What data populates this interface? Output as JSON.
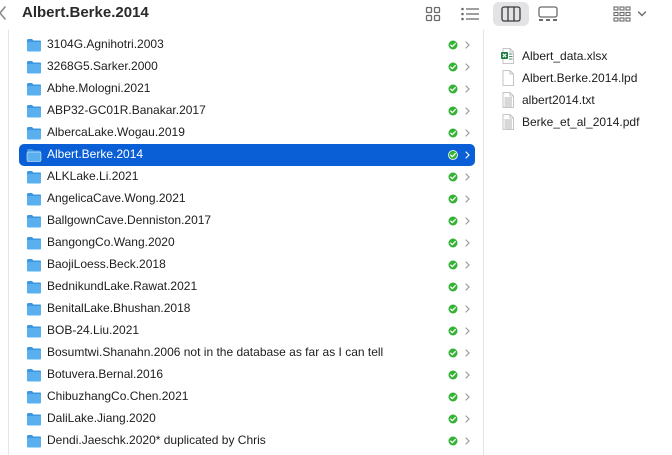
{
  "window": {
    "title": "Albert.Berke.2014"
  },
  "toolbar": {
    "icons": [
      "back-chevron-icon",
      "icon-view-icon",
      "list-view-icon",
      "column-view-icon",
      "gallery-view-icon",
      "group-by-icon",
      "chevron-down-icon"
    ]
  },
  "folders": [
    {
      "name": "3104G.Agnihotri.2003"
    },
    {
      "name": "3268G5.Sarker.2000"
    },
    {
      "name": "Abhe.Mologni.2021"
    },
    {
      "name": "ABP32-GC01R.Banakar.2017"
    },
    {
      "name": "AlbercaLake.Wogau.2019"
    },
    {
      "name": "Albert.Berke.2014"
    },
    {
      "name": "ALKLake.Li.2021"
    },
    {
      "name": "AngelicaCave.Wong.2021"
    },
    {
      "name": "BallgownCave.Denniston.2017"
    },
    {
      "name": "BangongCo.Wang.2020"
    },
    {
      "name": "BaojiLoess.Beck.2018"
    },
    {
      "name": "BednikundLake.Rawat.2021"
    },
    {
      "name": "BenitalLake.Bhushan.2018"
    },
    {
      "name": "BOB-24.Liu.2021"
    },
    {
      "name": "Bosumtwi.Shanahn.2006 not in the database as far as I can tell"
    },
    {
      "name": "Botuvera.Bernal.2016"
    },
    {
      "name": "ChibuzhangCo.Chen.2021"
    },
    {
      "name": "DaliLake.Jiang.2020"
    },
    {
      "name": "Dendi.Jaeschk.2020* duplicated by Chris"
    }
  ],
  "selected_folder": "Albert.Berke.2014",
  "files": [
    {
      "name": "Albert_data.xlsx",
      "icon": "excel-file-icon"
    },
    {
      "name": "Albert.Berke.2014.lpd",
      "icon": "document-icon"
    },
    {
      "name": "albert2014.txt",
      "icon": "text-file-icon"
    },
    {
      "name": "Berke_et_al_2014.pdf",
      "icon": "pdf-file-icon"
    }
  ],
  "colors": {
    "selection": "#0a5fd6",
    "folder": "#5ab0ef",
    "synced": "#34b233"
  }
}
